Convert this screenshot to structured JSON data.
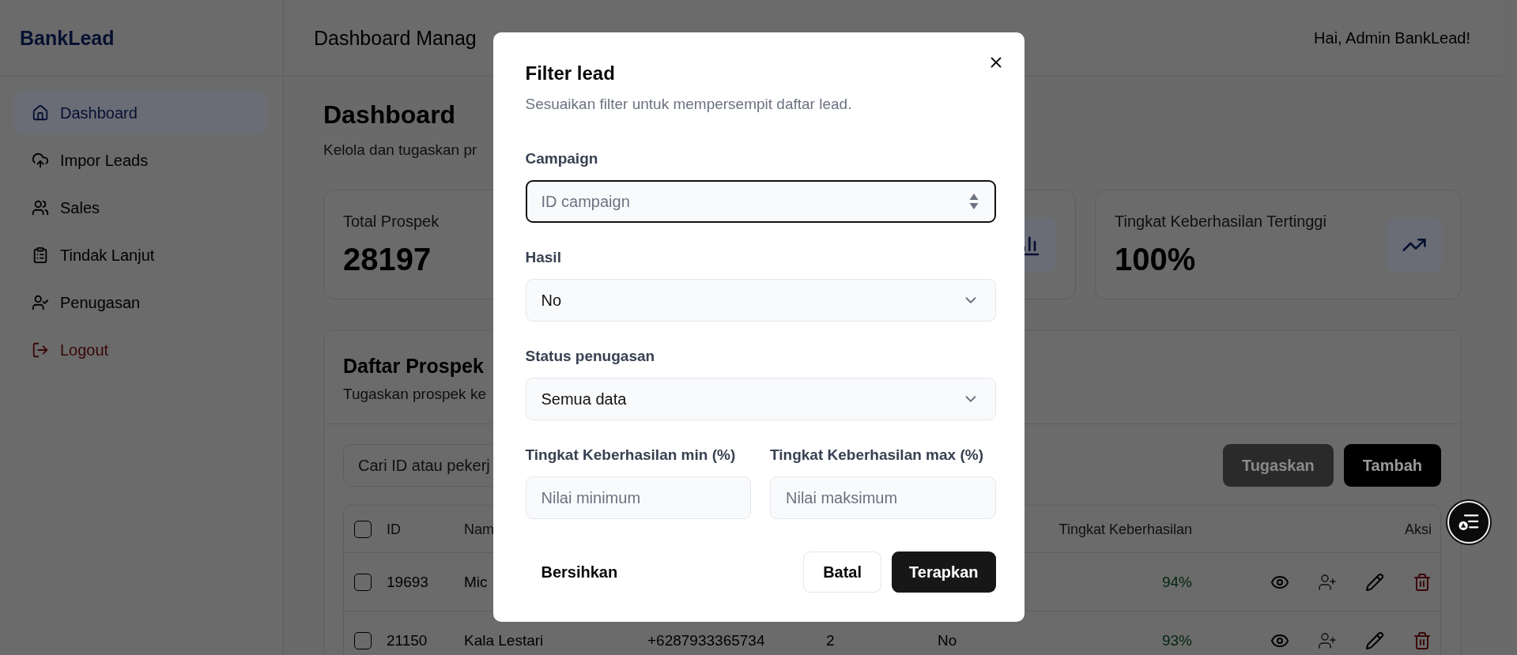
{
  "sidebar": {
    "logo": "BankLead",
    "items": [
      {
        "label": "Dashboard",
        "selected": true
      },
      {
        "label": "Impor Leads",
        "selected": false
      },
      {
        "label": "Sales",
        "selected": false
      },
      {
        "label": "Tindak Lanjut",
        "selected": false
      },
      {
        "label": "Penugasan",
        "selected": false
      }
    ],
    "logout": "Logout"
  },
  "header": {
    "title": "Dashboard Manag",
    "greeting": "Hai, Admin BankLead!"
  },
  "page": {
    "title": "Dashboard",
    "subtitle": "Kelola dan tugaskan pr"
  },
  "stat_cards": [
    {
      "kind": "plain",
      "title": "Total Prospek",
      "value": "28197"
    },
    {
      "kind": "chart"
    },
    {
      "kind": "trend",
      "title": "Tingkat Keberhasilan Tertinggi",
      "value": "100%"
    }
  ],
  "leads_panel": {
    "title": "Daftar Prospek",
    "subtitle": "Tugaskan prospek ke",
    "search": {
      "placeholder": "Cari ID atau pekerj"
    },
    "buttons": [
      {
        "label": "Tugaskan",
        "disabled": true
      },
      {
        "label": "Tambah",
        "disabled": false
      }
    ],
    "table": {
      "header": {
        "checked": false,
        "id": "ID",
        "column_2": "Nam",
        "success_rate": "Tingkat Keberhasilan",
        "actions": "Aksi"
      },
      "rows": [
        {
          "checked": false,
          "id": "19693",
          "column_2": "Mic",
          "success_rate": "94%"
        },
        {
          "checked": false,
          "id": "21150",
          "column_2": "Kala Lestari",
          "column_3": "+6287933365734",
          "column_4": "2",
          "column_5": "No",
          "success_rate": "93%"
        }
      ]
    }
  },
  "filter_dialog": {
    "title": "Filter lead",
    "description": "Sesuaikan filter untuk mempersempit daftar lead.",
    "campaign": {
      "label": "Campaign",
      "placeholder": "ID campaign",
      "focused": true
    },
    "result": {
      "label": "Hasil",
      "value": "No"
    },
    "assignment_status": {
      "label": "Status penugasan",
      "value": "Semua data"
    },
    "rate_min": {
      "label": "Tingkat Keberhasilan min (%)",
      "placeholder": "Nilai minimum"
    },
    "rate_max": {
      "label": "Tingkat Keberhasilan max (%)",
      "placeholder": "Nilai maksimum"
    },
    "buttons": {
      "clear": "Bersihkan",
      "cancel": "Batal",
      "apply": "Terapkan"
    }
  }
}
